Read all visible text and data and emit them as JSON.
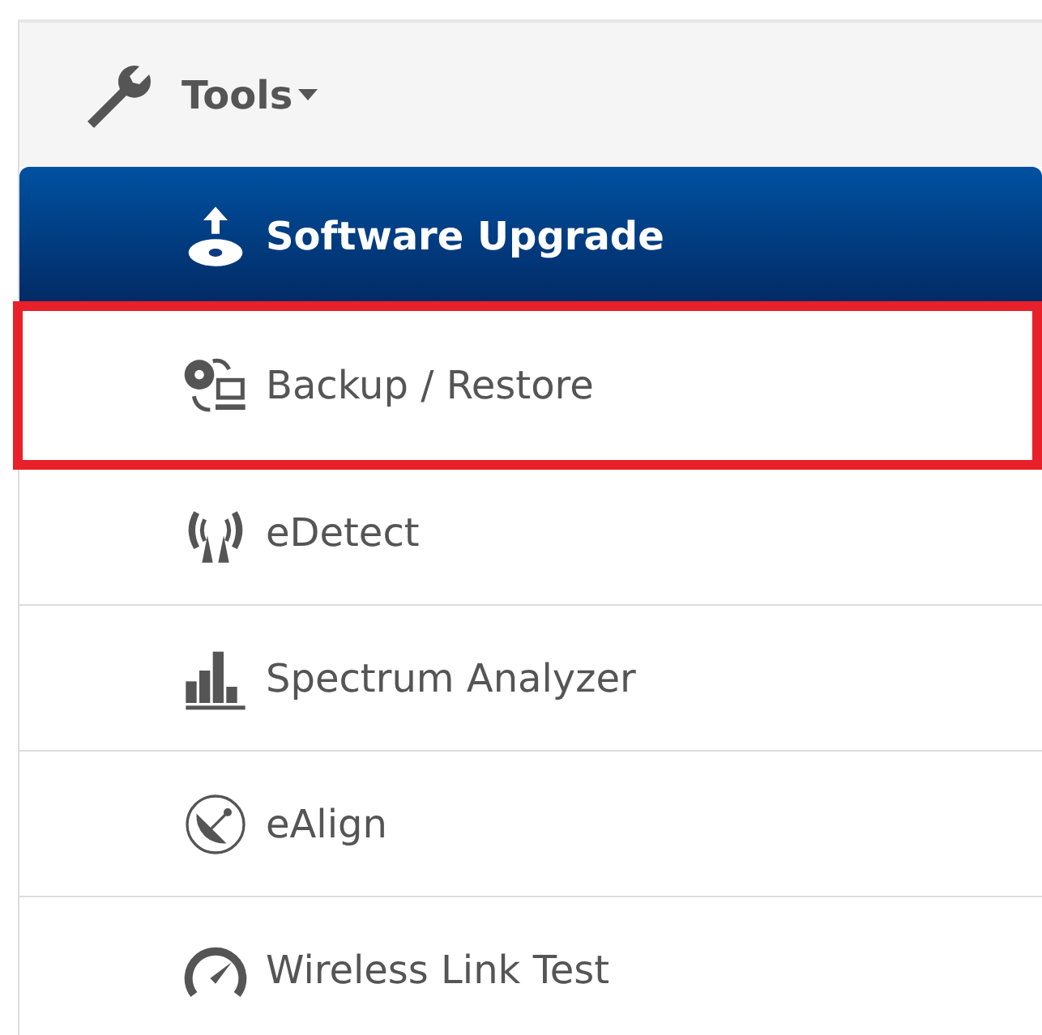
{
  "menu": {
    "title": "Tools",
    "items": [
      {
        "label": "Software Upgrade",
        "kind": "upgrade",
        "selected": true,
        "highlighted": false
      },
      {
        "label": "Backup / Restore",
        "kind": "backup",
        "selected": false,
        "highlighted": true
      },
      {
        "label": "eDetect",
        "kind": "detect",
        "selected": false,
        "highlighted": false
      },
      {
        "label": "Spectrum Analyzer",
        "kind": "bars",
        "selected": false,
        "highlighted": false
      },
      {
        "label": "eAlign",
        "kind": "dish",
        "selected": false,
        "highlighted": false
      },
      {
        "label": "Wireless Link Test",
        "kind": "gauge",
        "selected": false,
        "highlighted": false
      }
    ]
  }
}
